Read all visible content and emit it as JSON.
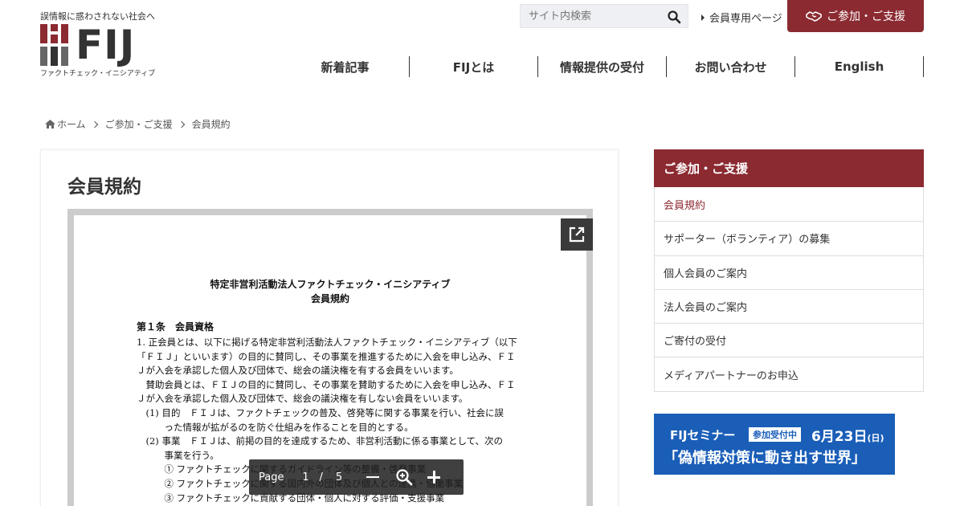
{
  "header": {
    "tagline": "誤情報に惑わされない社会へ",
    "logo_text": "FIJ",
    "logo_subtitle": "ファクトチェック・イニシアティブ",
    "search_placeholder": "サイト内検索",
    "member_link": "会員専用ページ",
    "join_button": "ご参加・ご支援",
    "accent_color": "#8b2a31"
  },
  "nav": {
    "items": [
      {
        "label": "新着記事"
      },
      {
        "label": "FIJとは"
      },
      {
        "label": "情報提供の受付"
      },
      {
        "label": "お問い合わせ"
      },
      {
        "label": "English"
      }
    ]
  },
  "breadcrumb": {
    "home": "ホーム",
    "parent": "ご参加・ご支援",
    "current": "会員規約"
  },
  "main": {
    "title": "会員規約",
    "pdf": {
      "org": "特定非営利活動法人ファクトチェック・イニシアティブ",
      "doc_title": "会員規約",
      "article": "第１条　会員資格",
      "lines": [
        "1. 正会員とは、以下に掲げる特定非営利活動法人ファクトチェック・イニシアティブ（以下",
        "「ＦＩＪ」といいます）の目的に賛同し、その事業を推進するために入会を申し込み、ＦＩ",
        "Ｊが入会を承認した個人及び団体で、総会の議決権を有する会員をいいます。",
        "　賛助会員とは、ＦＩＪの目的に賛同し、その事業を賛助するために入会を申し込み、ＦＩ",
        "Ｊが入会を承認した個人及び団体で、総会の議決権を有しない会員をいいます。",
        "　(1) 目的　ＦＩＪは、ファクトチェックの普及、啓発等に関する事業を行い、社会に誤",
        "　　　った情報が拡がるのを防ぐ仕組みを作ることを目的とする。",
        "　(2) 事業　ＦＩＪは、前掲の目的を達成するため、非営利活動に係る事業として、次の",
        "　　　事業を行う。",
        "　　　① ファクトチェックに関するガイドライン等の整備・啓発事業",
        "　　　② ファクトチェックに関する国内外の団体及び個人との連携・協働事業",
        "　　　③ ファクトチェックに貢献する団体・個人に対する評価・支援事業"
      ],
      "toolbar": {
        "page_label": "Page",
        "current_page": "1",
        "separator": "/",
        "total_pages": "5"
      }
    }
  },
  "sidebar": {
    "heading": "ご参加・ご支援",
    "items": [
      {
        "label": "会員規約",
        "active": true
      },
      {
        "label": "サポーター（ボランティア）の募集"
      },
      {
        "label": "個人会員のご案内"
      },
      {
        "label": "法人会員のご案内"
      },
      {
        "label": "ご寄付の受付"
      },
      {
        "label": "メディアパートナーのお申込"
      }
    ]
  },
  "banner": {
    "seminar": "FIJセミナー",
    "badge": "参加受付中",
    "date": "6月23日",
    "weekday": "(日)",
    "headline": "「偽情報対策に動き出す世界」",
    "color": "#1a5eb8"
  }
}
